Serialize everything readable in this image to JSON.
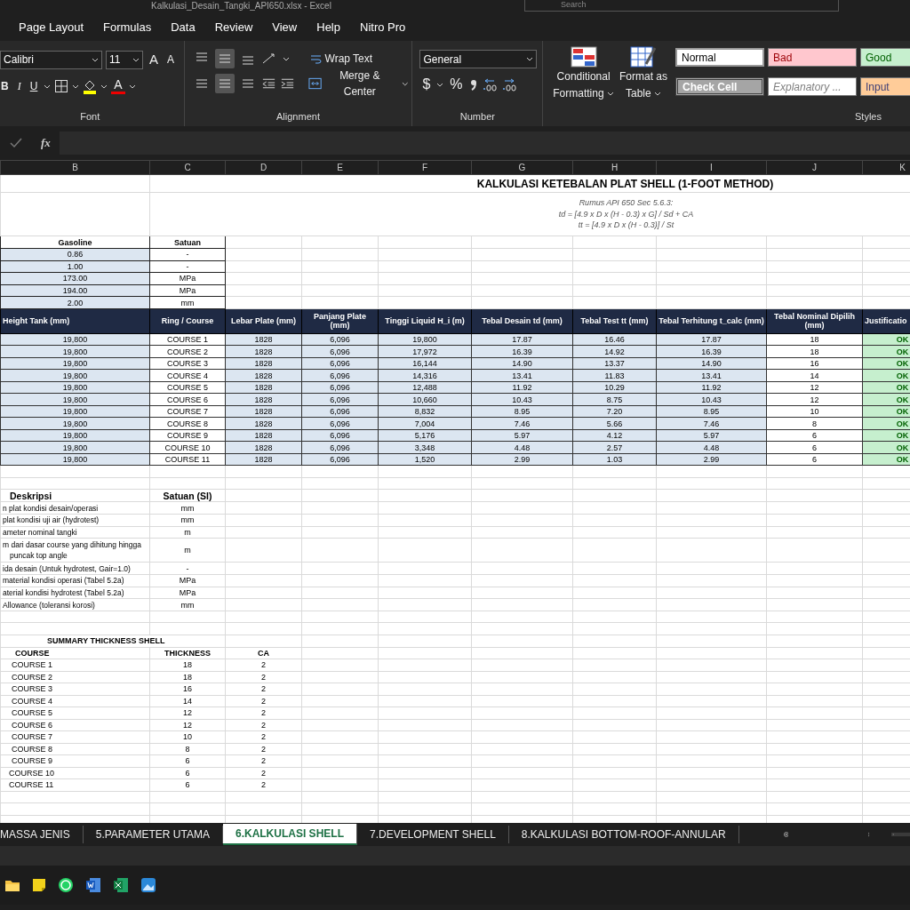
{
  "window": {
    "title": "Kalkulasi_Desain_Tangki_API650.xlsx - Excel",
    "search_placeholder": "Search"
  },
  "ribbon": {
    "tabs": [
      {
        "label": "Page Layout",
        "selected": false
      },
      {
        "label": "Formulas",
        "selected": false
      },
      {
        "label": "Data",
        "selected": false
      },
      {
        "label": "Review",
        "selected": false
      },
      {
        "label": "View",
        "selected": false
      },
      {
        "label": "Help",
        "selected": false
      },
      {
        "label": "Nitro Pro",
        "selected": false
      }
    ],
    "font": {
      "group": "Font",
      "name": "Calibri",
      "size": "11",
      "grow": "A",
      "shrink": "A",
      "bold": "B",
      "italic": "I",
      "underline": "U",
      "font_color": "A"
    },
    "alignment": {
      "group": "Alignment",
      "vertical": [
        {
          "selected": false
        },
        {
          "selected": true
        },
        {
          "selected": false
        }
      ],
      "horizontal": [
        {
          "selected": false
        },
        {
          "selected": true
        },
        {
          "selected": false
        }
      ],
      "wrap": "Wrap Text",
      "merge": "Merge & Center"
    },
    "number": {
      "group": "Number",
      "format": "General",
      "currency": "$",
      "percent": "%"
    },
    "styles": {
      "group": "Styles",
      "conditional": "Conditional",
      "conditional_2": "Formatting",
      "table": "Format as",
      "table_2": "Table",
      "cells": [
        {
          "label": "Normal",
          "kind": "normal"
        },
        {
          "label": "Bad",
          "kind": "bad"
        },
        {
          "label": "Good",
          "kind": "good"
        },
        {
          "label": "Check Cell",
          "kind": "check"
        },
        {
          "label": "Explanatory ...",
          "kind": "explanatory"
        },
        {
          "label": "Input",
          "kind": "input"
        }
      ]
    }
  },
  "formula_bar": {
    "fx": "fx"
  },
  "sheet": {
    "columns": [
      "B",
      "C",
      "D",
      "E",
      "F",
      "G",
      "H",
      "I",
      "J",
      "K"
    ],
    "title": "KALKULASI KETEBALAN PLAT SHELL (1-FOOT METHOD)",
    "formula_lines": [
      "Rumus API 650 Sec 5.6.3:",
      "td = [4.9 x D x (H - 0.3) x G] / Sd + CA",
      "tt = [4.9 x D x (H - 0.3)] / St"
    ],
    "params_header": [
      "Gasoline",
      "Satuan"
    ],
    "params": [
      [
        "0.86",
        "-"
      ],
      [
        "1.00",
        "-"
      ],
      [
        "173.00",
        "MPa"
      ],
      [
        "194.00",
        "MPa"
      ],
      [
        "2.00",
        "mm"
      ]
    ],
    "table_header": [
      "Height Tank (mm)",
      "Ring / Course",
      "Lebar Plate (mm)",
      "Panjang Plate (mm)",
      "Tinggi Liquid H_i (m)",
      "Tebal Desain td (mm)",
      "Tebal Test tt (mm)",
      "Tebal Terhitung t_calc (mm)",
      "Tebal Nominal Dipilih (mm)",
      "Justificatio"
    ],
    "rows": [
      [
        "19,800",
        "COURSE 1",
        "1828",
        "6,096",
        "19,800",
        "17.87",
        "16.46",
        "17.87",
        "18",
        "OK"
      ],
      [
        "19,800",
        "COURSE 2",
        "1828",
        "6,096",
        "17,972",
        "16.39",
        "14.92",
        "16.39",
        "18",
        "OK"
      ],
      [
        "19,800",
        "COURSE 3",
        "1828",
        "6,096",
        "16,144",
        "14.90",
        "13.37",
        "14.90",
        "16",
        "OK"
      ],
      [
        "19,800",
        "COURSE 4",
        "1828",
        "6,096",
        "14,316",
        "13.41",
        "11.83",
        "13.41",
        "14",
        "OK"
      ],
      [
        "19,800",
        "COURSE 5",
        "1828",
        "6,096",
        "12,488",
        "11.92",
        "10.29",
        "11.92",
        "12",
        "OK"
      ],
      [
        "19,800",
        "COURSE 6",
        "1828",
        "6,096",
        "10,660",
        "10.43",
        "8.75",
        "10.43",
        "12",
        "OK"
      ],
      [
        "19,800",
        "COURSE 7",
        "1828",
        "6,096",
        "8,832",
        "8.95",
        "7.20",
        "8.95",
        "10",
        "OK"
      ],
      [
        "19,800",
        "COURSE 8",
        "1828",
        "6,096",
        "7,004",
        "7.46",
        "5.66",
        "7.46",
        "8",
        "OK"
      ],
      [
        "19,800",
        "COURSE 9",
        "1828",
        "6,096",
        "5,176",
        "5.97",
        "4.12",
        "5.97",
        "6",
        "OK"
      ],
      [
        "19,800",
        "COURSE 10",
        "1828",
        "6,096",
        "3,348",
        "4.48",
        "2.57",
        "4.48",
        "6",
        "OK"
      ],
      [
        "19,800",
        "COURSE 11",
        "1828",
        "6,096",
        "1,520",
        "2.99",
        "1.03",
        "2.99",
        "6",
        "OK"
      ]
    ],
    "desc_header": [
      "Deskripsi",
      "Satuan (SI)"
    ],
    "descriptions": [
      {
        "lines": [
          "n plat kondisi desain/operasi"
        ],
        "unit": "mm"
      },
      {
        "lines": [
          "plat kondisi uji air (hydrotest)"
        ],
        "unit": "mm"
      },
      {
        "lines": [
          "ameter nominal tangki"
        ],
        "unit": "m"
      },
      {
        "lines": [
          "m dari dasar course yang dihitung hingga",
          "puncak top angle"
        ],
        "unit": "m"
      },
      {
        "lines": [
          "ida desain (Untuk hydrotest, Gair=1.0)"
        ],
        "unit": "-"
      },
      {
        "lines": [
          "material kondisi operasi (Tabel 5.2a)"
        ],
        "unit": "MPa"
      },
      {
        "lines": [
          "aterial kondisi hydrotest (Tabel 5.2a)"
        ],
        "unit": "MPa"
      },
      {
        "lines": [
          "Allowance (toleransi korosi)"
        ],
        "unit": "mm"
      }
    ],
    "summary_title": "SUMMARY THICKNESS SHELL",
    "summary_header": [
      "COURSE",
      "THICKNESS",
      "CA"
    ],
    "summary": [
      [
        "COURSE 1",
        "18",
        "2"
      ],
      [
        "COURSE 2",
        "18",
        "2"
      ],
      [
        "COURSE 3",
        "16",
        "2"
      ],
      [
        "COURSE 4",
        "14",
        "2"
      ],
      [
        "COURSE 5",
        "12",
        "2"
      ],
      [
        "COURSE 6",
        "12",
        "2"
      ],
      [
        "COURSE 7",
        "10",
        "2"
      ],
      [
        "COURSE 8",
        "8",
        "2"
      ],
      [
        "COURSE 9",
        "6",
        "2"
      ],
      [
        "COURSE 10",
        "6",
        "2"
      ],
      [
        "COURSE 11",
        "6",
        "2"
      ]
    ]
  },
  "sheet_tabs": [
    {
      "label": "MASSA JENIS",
      "selected": false
    },
    {
      "label": "5.PARAMETER UTAMA",
      "selected": false
    },
    {
      "label": "6.KALKULASI SHELL",
      "selected": true
    },
    {
      "label": "7.DEVELOPMENT SHELL",
      "selected": false
    },
    {
      "label": "8.KALKULASI BOTTOM-ROOF-ANNULAR",
      "selected": false
    }
  ]
}
